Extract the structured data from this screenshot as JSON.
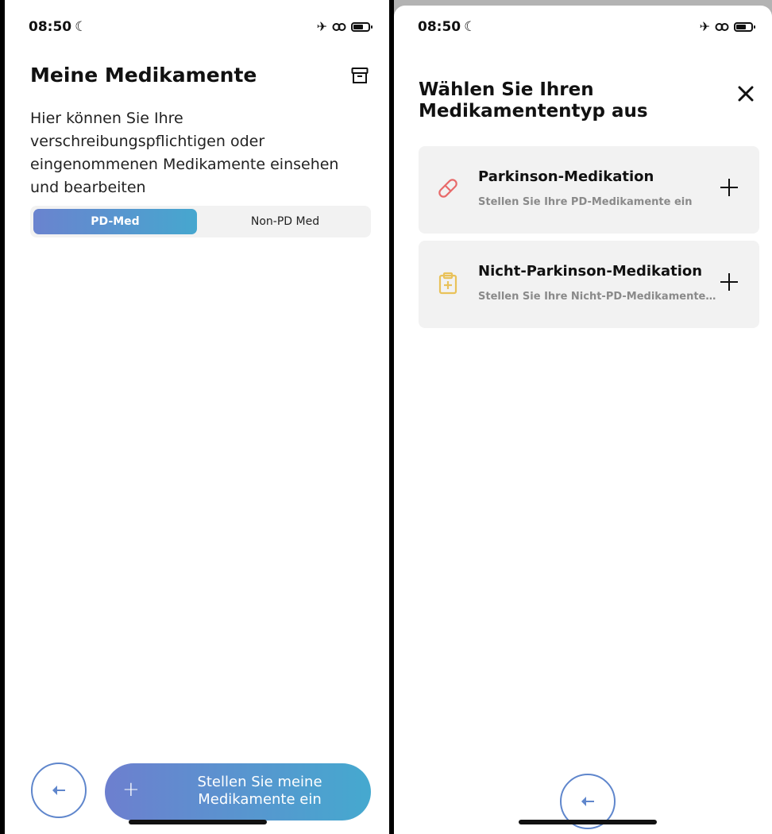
{
  "left": {
    "status": {
      "time": "08:50"
    },
    "title": "Meine Medikamente",
    "description": "Hier können Sie Ihre verschreibungspflichtigen oder eingenommenen Medikamente einsehen und bearbeiten",
    "tabs": [
      {
        "label": "PD-Med",
        "active": true
      },
      {
        "label": "Non-PD Med",
        "active": false
      }
    ],
    "cta_label": "Stellen Sie meine Medikamente ein",
    "icons": {
      "archive": "archive-icon",
      "back": "arrow-left-icon",
      "plus": "plus-icon"
    }
  },
  "right": {
    "status": {
      "time": "08:50"
    },
    "title": "Wählen Sie Ihren Medikamententyp aus",
    "options": [
      {
        "title": "Parkinson-Medikation",
        "subtitle": "Stellen Sie Ihre PD-Medikamente ein",
        "icon": "pill-icon"
      },
      {
        "title": "Nicht-Parkinson-Medikation",
        "subtitle": "Stellen Sie Ihre Nicht-PD-Medikamente ein",
        "icon": "clipboard-plus-icon"
      }
    ],
    "icons": {
      "close": "close-icon",
      "back": "arrow-left-icon"
    }
  },
  "colors": {
    "accent_gradient_start": "#6a83cf",
    "accent_gradient_end": "#46a7cf",
    "pill_icon": "#e86a6a",
    "clipboard_icon": "#e9c25a",
    "card_bg": "#f2f2f2"
  }
}
